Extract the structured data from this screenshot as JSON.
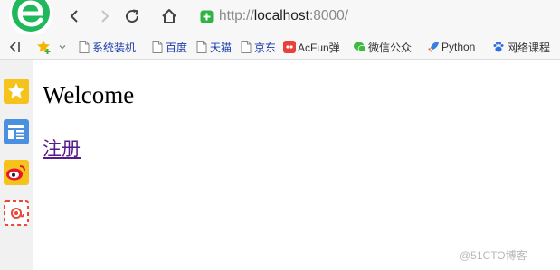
{
  "colors": {
    "chrome_background": "#f7f7f7",
    "logo_green": "#1fb85b",
    "secure_green": "#2fb344",
    "link_visited": "#551a8b",
    "folder_text": "#1a3aa8"
  },
  "address_bar": {
    "url_scheme": "http://",
    "url_host": "localhost",
    "url_rest": ":8000/",
    "secure_icon": "shield-check-icon"
  },
  "bookmarks": {
    "items": [
      {
        "label": "系统装机",
        "icon": "page-icon"
      },
      {
        "label": "百度",
        "icon": "page-icon"
      },
      {
        "label": "天猫",
        "icon": "page-icon"
      },
      {
        "label": "京东",
        "icon": "page-icon"
      },
      {
        "label": "AcFun弹",
        "icon": "acfun-icon"
      },
      {
        "label": "微信公众",
        "icon": "wechat-icon"
      },
      {
        "label": "Python",
        "icon": "rocket-icon"
      },
      {
        "label": "网络课程",
        "icon": "paw-icon"
      }
    ]
  },
  "sidebar": {
    "items": [
      {
        "icon": "favorites-star-icon"
      },
      {
        "icon": "news-icon"
      },
      {
        "icon": "weibo-icon"
      },
      {
        "icon": "mail-icon"
      }
    ]
  },
  "page": {
    "heading": "Welcome",
    "link": "注册"
  },
  "watermark": "@51CTO博客"
}
